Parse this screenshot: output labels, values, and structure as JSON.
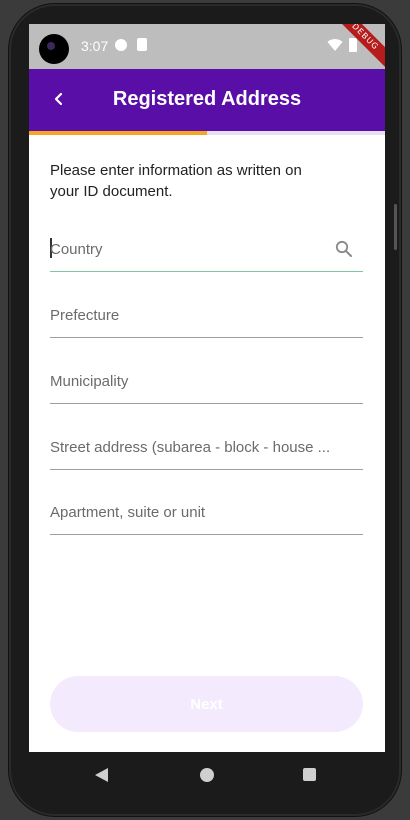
{
  "status_bar": {
    "time": "3:07",
    "debug_banner": "DEBUG"
  },
  "app_bar": {
    "title": "Registered Address",
    "background_color": "#5a0ea8"
  },
  "progress": {
    "fraction": 0.5,
    "fill_color": "#f5a623"
  },
  "form": {
    "instructions": "Please enter information as written on your ID document.",
    "fields": [
      {
        "name": "country",
        "placeholder": "Country",
        "value": "",
        "icon": "search-icon"
      },
      {
        "name": "prefecture",
        "placeholder": "Prefecture",
        "value": ""
      },
      {
        "name": "municipality",
        "placeholder": "Municipality",
        "value": ""
      },
      {
        "name": "street-address",
        "placeholder": "Street address (subarea - block - house ...",
        "value": ""
      },
      {
        "name": "apartment",
        "placeholder": "Apartment, suite or unit",
        "value": ""
      }
    ]
  },
  "next_button": {
    "label": "Next",
    "enabled": false
  }
}
